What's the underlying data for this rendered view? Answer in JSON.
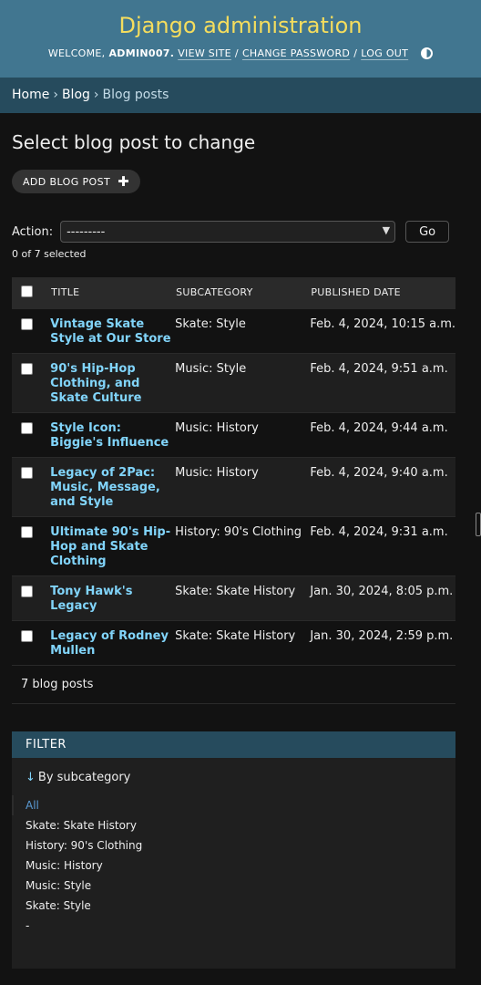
{
  "header": {
    "site_title": "Django administration",
    "welcome": "WELCOME,",
    "username": "ADMIN007.",
    "view_site": "VIEW SITE",
    "change_password": "CHANGE PASSWORD",
    "log_out": "LOG OUT",
    "separator": "/"
  },
  "breadcrumbs": {
    "home": "Home",
    "app": "Blog",
    "model": "Blog posts",
    "separator": "›"
  },
  "page_title": "Select blog post to change",
  "add_button_label": "ADD BLOG POST",
  "actions": {
    "label": "Action:",
    "selected_option": "---------",
    "go_label": "Go",
    "selected_count": "0 of 7 selected"
  },
  "table": {
    "columns": [
      "TITLE",
      "SUBCATEGORY",
      "PUBLISHED DATE"
    ],
    "rows": [
      {
        "title": "Vintage Skate Style at Our Store",
        "subcategory": "Skate: Style",
        "published": "Feb. 4, 2024, 10:15 a.m."
      },
      {
        "title": "90's Hip-Hop Clothing, and Skate Culture",
        "subcategory": "Music: Style",
        "published": "Feb. 4, 2024, 9:51 a.m."
      },
      {
        "title": "Style Icon: Biggie's Influence",
        "subcategory": "Music: History",
        "published": "Feb. 4, 2024, 9:44 a.m."
      },
      {
        "title": "Legacy of 2Pac: Music, Message, and Style",
        "subcategory": "Music: History",
        "published": "Feb. 4, 2024, 9:40 a.m."
      },
      {
        "title": "Ultimate 90's Hip-Hop and Skate Clothing",
        "subcategory": "History: 90's Clothing",
        "published": "Feb. 4, 2024, 9:31 a.m."
      },
      {
        "title": "Tony Hawk's Legacy",
        "subcategory": "Skate: Skate History",
        "published": "Jan. 30, 2024, 8:05 p.m."
      },
      {
        "title": "Legacy of Rodney Mullen",
        "subcategory": "Skate: Skate History",
        "published": "Jan. 30, 2024, 2:59 p.m."
      }
    ]
  },
  "paginator": "7 blog posts",
  "filter": {
    "heading": "FILTER",
    "by_label": "By subcategory",
    "options": [
      "All",
      "Skate: Skate History",
      "History: 90's Clothing",
      "Music: History",
      "Music: Style",
      "Skate: Style",
      "-"
    ],
    "selected": "All"
  },
  "colors": {
    "header_bg": "#417690",
    "breadcrumbs_bg": "#264b5d",
    "site_title": "#f5dd5d",
    "link": "#81d4fa",
    "background": "#121212"
  },
  "icons": {
    "add": "plus-icon",
    "theme": "theme-toggle-icon",
    "filter_sort": "down-arrow-icon",
    "select": "chevron-down-icon"
  }
}
